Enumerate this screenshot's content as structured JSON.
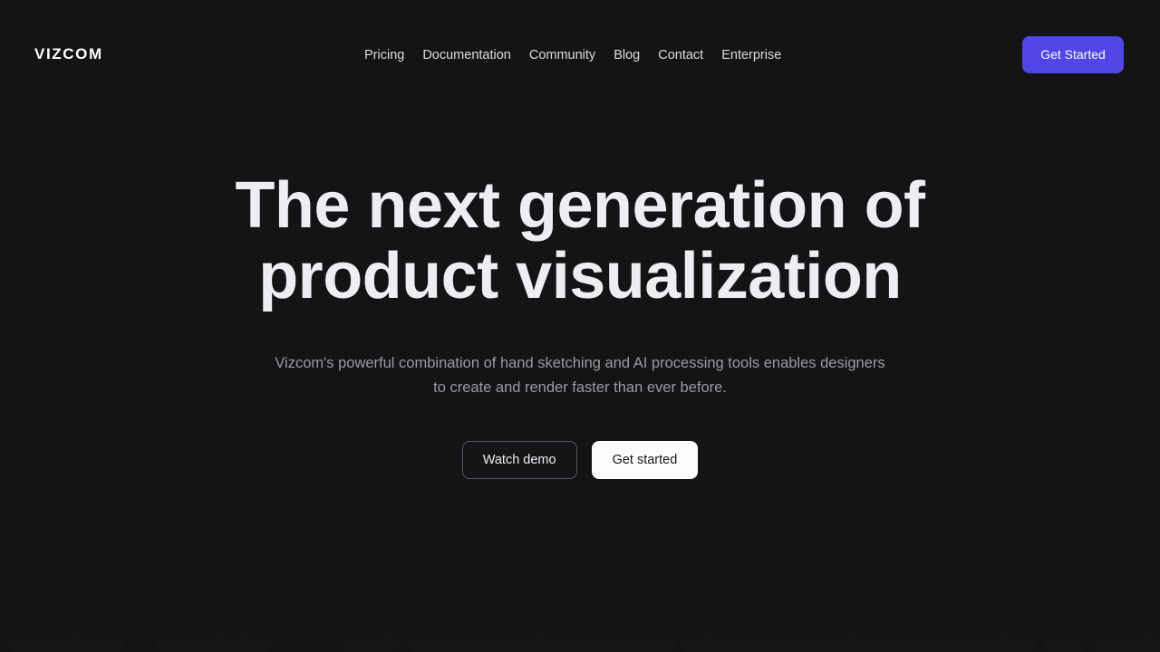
{
  "header": {
    "brand": "VIZCOM",
    "nav": [
      {
        "label": "Pricing"
      },
      {
        "label": "Documentation"
      },
      {
        "label": "Community"
      },
      {
        "label": "Blog"
      },
      {
        "label": "Contact"
      },
      {
        "label": "Enterprise"
      }
    ],
    "cta_label": "Get Started",
    "cta_color": "#4f46e5"
  },
  "hero": {
    "title_line1": "The next generation of",
    "title_line2": "product visualization",
    "subtitle": "Vizcom's powerful combination of hand sketching and AI processing tools enables designers to create and render faster than ever before.",
    "primary_button": "Watch demo",
    "secondary_button": "Get started"
  },
  "theme": {
    "background": "#141416",
    "title_color": "#eeeef2",
    "subtitle_color": "#9a9aa0",
    "nav_color": "#dcdce0",
    "accent": "#4f46e5",
    "light_button_bg": "#fbfbfb"
  }
}
